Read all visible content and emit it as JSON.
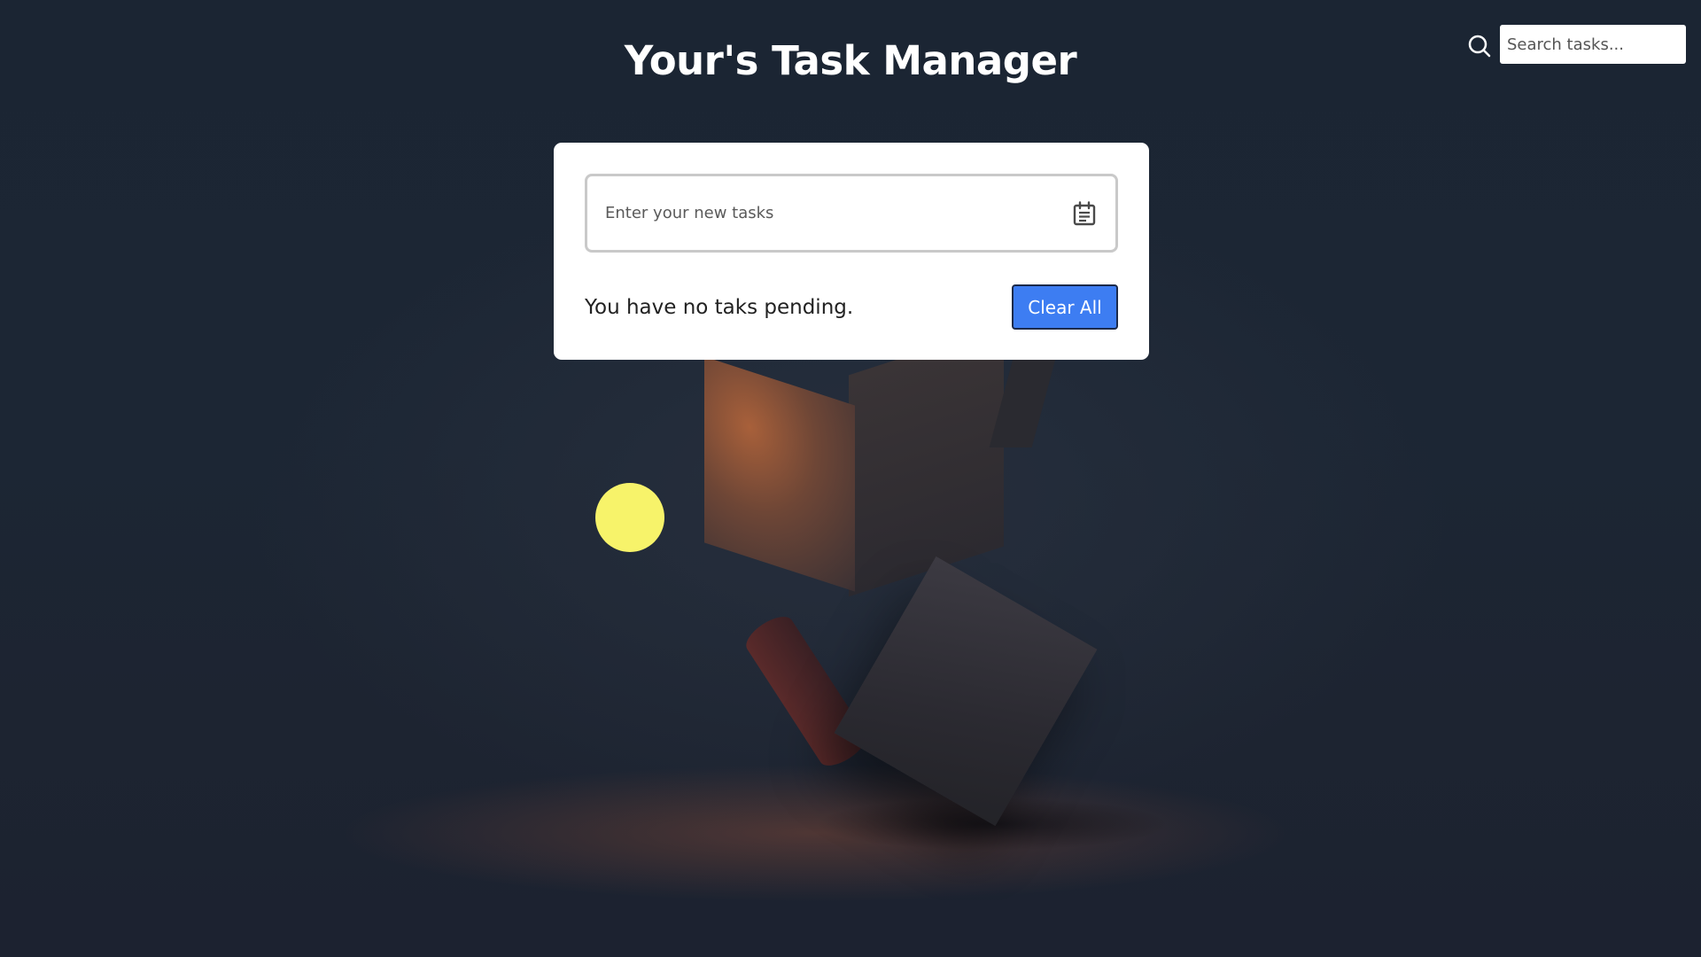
{
  "header": {
    "title": "Your's Task Manager"
  },
  "search": {
    "placeholder": "Search tasks...",
    "icon": "search-icon"
  },
  "card": {
    "task_input_placeholder": "Enter your new tasks",
    "task_input_icon": "calendar-icon",
    "pending_text": "You have no taks pending.",
    "clear_button_label": "Clear All"
  },
  "colors": {
    "background": "#1a2230",
    "card": "#ffffff",
    "accent_button": "#3d7df2",
    "sun": "#f7f36a"
  }
}
